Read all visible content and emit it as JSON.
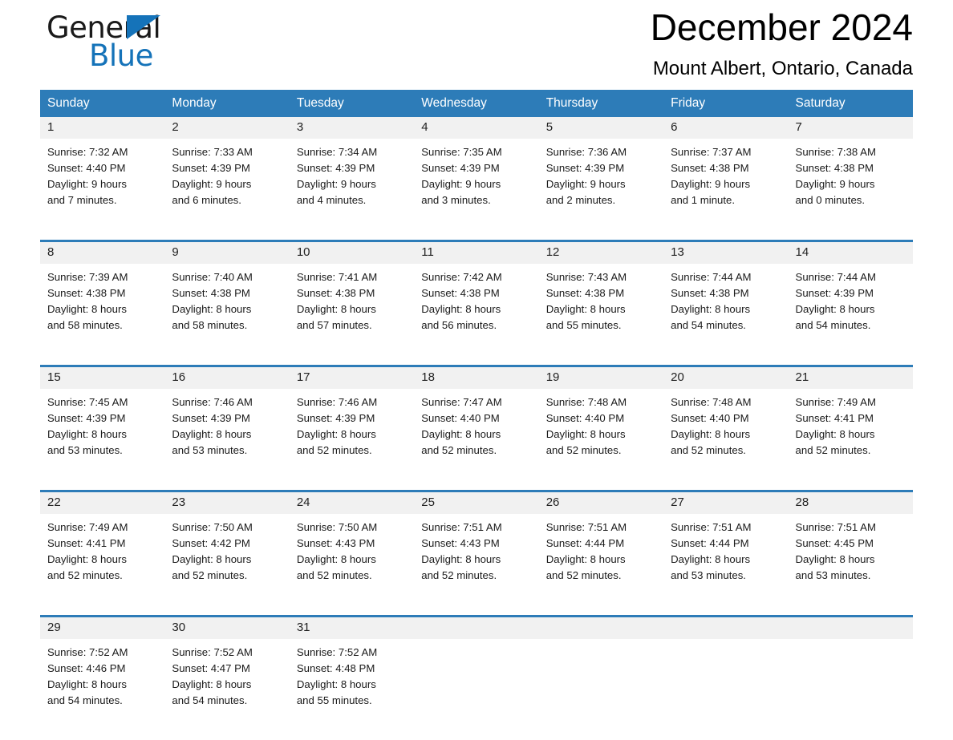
{
  "brand": {
    "name_part1": "General",
    "name_part2": "Blue",
    "triangle_icon": "blue-triangle-icon",
    "accent_color": "#1573b9"
  },
  "header": {
    "title": "December 2024",
    "subtitle": "Mount Albert, Ontario, Canada"
  },
  "colors": {
    "header_blue": "#2d7cb8",
    "daynum_band": "#f1f1f1",
    "text": "#1a1a1a"
  },
  "weekdays": [
    "Sunday",
    "Monday",
    "Tuesday",
    "Wednesday",
    "Thursday",
    "Friday",
    "Saturday"
  ],
  "weeks": [
    [
      {
        "day": "1",
        "sunrise": "Sunrise: 7:32 AM",
        "sunset": "Sunset: 4:40 PM",
        "daylight_line1": "Daylight: 9 hours",
        "daylight_line2": "and 7 minutes."
      },
      {
        "day": "2",
        "sunrise": "Sunrise: 7:33 AM",
        "sunset": "Sunset: 4:39 PM",
        "daylight_line1": "Daylight: 9 hours",
        "daylight_line2": "and 6 minutes."
      },
      {
        "day": "3",
        "sunrise": "Sunrise: 7:34 AM",
        "sunset": "Sunset: 4:39 PM",
        "daylight_line1": "Daylight: 9 hours",
        "daylight_line2": "and 4 minutes."
      },
      {
        "day": "4",
        "sunrise": "Sunrise: 7:35 AM",
        "sunset": "Sunset: 4:39 PM",
        "daylight_line1": "Daylight: 9 hours",
        "daylight_line2": "and 3 minutes."
      },
      {
        "day": "5",
        "sunrise": "Sunrise: 7:36 AM",
        "sunset": "Sunset: 4:39 PM",
        "daylight_line1": "Daylight: 9 hours",
        "daylight_line2": "and 2 minutes."
      },
      {
        "day": "6",
        "sunrise": "Sunrise: 7:37 AM",
        "sunset": "Sunset: 4:38 PM",
        "daylight_line1": "Daylight: 9 hours",
        "daylight_line2": "and 1 minute."
      },
      {
        "day": "7",
        "sunrise": "Sunrise: 7:38 AM",
        "sunset": "Sunset: 4:38 PM",
        "daylight_line1": "Daylight: 9 hours",
        "daylight_line2": "and 0 minutes."
      }
    ],
    [
      {
        "day": "8",
        "sunrise": "Sunrise: 7:39 AM",
        "sunset": "Sunset: 4:38 PM",
        "daylight_line1": "Daylight: 8 hours",
        "daylight_line2": "and 58 minutes."
      },
      {
        "day": "9",
        "sunrise": "Sunrise: 7:40 AM",
        "sunset": "Sunset: 4:38 PM",
        "daylight_line1": "Daylight: 8 hours",
        "daylight_line2": "and 58 minutes."
      },
      {
        "day": "10",
        "sunrise": "Sunrise: 7:41 AM",
        "sunset": "Sunset: 4:38 PM",
        "daylight_line1": "Daylight: 8 hours",
        "daylight_line2": "and 57 minutes."
      },
      {
        "day": "11",
        "sunrise": "Sunrise: 7:42 AM",
        "sunset": "Sunset: 4:38 PM",
        "daylight_line1": "Daylight: 8 hours",
        "daylight_line2": "and 56 minutes."
      },
      {
        "day": "12",
        "sunrise": "Sunrise: 7:43 AM",
        "sunset": "Sunset: 4:38 PM",
        "daylight_line1": "Daylight: 8 hours",
        "daylight_line2": "and 55 minutes."
      },
      {
        "day": "13",
        "sunrise": "Sunrise: 7:44 AM",
        "sunset": "Sunset: 4:38 PM",
        "daylight_line1": "Daylight: 8 hours",
        "daylight_line2": "and 54 minutes."
      },
      {
        "day": "14",
        "sunrise": "Sunrise: 7:44 AM",
        "sunset": "Sunset: 4:39 PM",
        "daylight_line1": "Daylight: 8 hours",
        "daylight_line2": "and 54 minutes."
      }
    ],
    [
      {
        "day": "15",
        "sunrise": "Sunrise: 7:45 AM",
        "sunset": "Sunset: 4:39 PM",
        "daylight_line1": "Daylight: 8 hours",
        "daylight_line2": "and 53 minutes."
      },
      {
        "day": "16",
        "sunrise": "Sunrise: 7:46 AM",
        "sunset": "Sunset: 4:39 PM",
        "daylight_line1": "Daylight: 8 hours",
        "daylight_line2": "and 53 minutes."
      },
      {
        "day": "17",
        "sunrise": "Sunrise: 7:46 AM",
        "sunset": "Sunset: 4:39 PM",
        "daylight_line1": "Daylight: 8 hours",
        "daylight_line2": "and 52 minutes."
      },
      {
        "day": "18",
        "sunrise": "Sunrise: 7:47 AM",
        "sunset": "Sunset: 4:40 PM",
        "daylight_line1": "Daylight: 8 hours",
        "daylight_line2": "and 52 minutes."
      },
      {
        "day": "19",
        "sunrise": "Sunrise: 7:48 AM",
        "sunset": "Sunset: 4:40 PM",
        "daylight_line1": "Daylight: 8 hours",
        "daylight_line2": "and 52 minutes."
      },
      {
        "day": "20",
        "sunrise": "Sunrise: 7:48 AM",
        "sunset": "Sunset: 4:40 PM",
        "daylight_line1": "Daylight: 8 hours",
        "daylight_line2": "and 52 minutes."
      },
      {
        "day": "21",
        "sunrise": "Sunrise: 7:49 AM",
        "sunset": "Sunset: 4:41 PM",
        "daylight_line1": "Daylight: 8 hours",
        "daylight_line2": "and 52 minutes."
      }
    ],
    [
      {
        "day": "22",
        "sunrise": "Sunrise: 7:49 AM",
        "sunset": "Sunset: 4:41 PM",
        "daylight_line1": "Daylight: 8 hours",
        "daylight_line2": "and 52 minutes."
      },
      {
        "day": "23",
        "sunrise": "Sunrise: 7:50 AM",
        "sunset": "Sunset: 4:42 PM",
        "daylight_line1": "Daylight: 8 hours",
        "daylight_line2": "and 52 minutes."
      },
      {
        "day": "24",
        "sunrise": "Sunrise: 7:50 AM",
        "sunset": "Sunset: 4:43 PM",
        "daylight_line1": "Daylight: 8 hours",
        "daylight_line2": "and 52 minutes."
      },
      {
        "day": "25",
        "sunrise": "Sunrise: 7:51 AM",
        "sunset": "Sunset: 4:43 PM",
        "daylight_line1": "Daylight: 8 hours",
        "daylight_line2": "and 52 minutes."
      },
      {
        "day": "26",
        "sunrise": "Sunrise: 7:51 AM",
        "sunset": "Sunset: 4:44 PM",
        "daylight_line1": "Daylight: 8 hours",
        "daylight_line2": "and 52 minutes."
      },
      {
        "day": "27",
        "sunrise": "Sunrise: 7:51 AM",
        "sunset": "Sunset: 4:44 PM",
        "daylight_line1": "Daylight: 8 hours",
        "daylight_line2": "and 53 minutes."
      },
      {
        "day": "28",
        "sunrise": "Sunrise: 7:51 AM",
        "sunset": "Sunset: 4:45 PM",
        "daylight_line1": "Daylight: 8 hours",
        "daylight_line2": "and 53 minutes."
      }
    ],
    [
      {
        "day": "29",
        "sunrise": "Sunrise: 7:52 AM",
        "sunset": "Sunset: 4:46 PM",
        "daylight_line1": "Daylight: 8 hours",
        "daylight_line2": "and 54 minutes."
      },
      {
        "day": "30",
        "sunrise": "Sunrise: 7:52 AM",
        "sunset": "Sunset: 4:47 PM",
        "daylight_line1": "Daylight: 8 hours",
        "daylight_line2": "and 54 minutes."
      },
      {
        "day": "31",
        "sunrise": "Sunrise: 7:52 AM",
        "sunset": "Sunset: 4:48 PM",
        "daylight_line1": "Daylight: 8 hours",
        "daylight_line2": "and 55 minutes."
      },
      {
        "day": "",
        "sunrise": "",
        "sunset": "",
        "daylight_line1": "",
        "daylight_line2": ""
      },
      {
        "day": "",
        "sunrise": "",
        "sunset": "",
        "daylight_line1": "",
        "daylight_line2": ""
      },
      {
        "day": "",
        "sunrise": "",
        "sunset": "",
        "daylight_line1": "",
        "daylight_line2": ""
      },
      {
        "day": "",
        "sunrise": "",
        "sunset": "",
        "daylight_line1": "",
        "daylight_line2": ""
      }
    ]
  ]
}
